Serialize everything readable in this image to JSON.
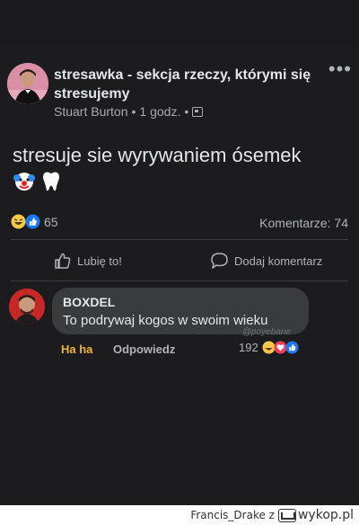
{
  "post": {
    "group_title": "stresawka - sekcja rzeczy, którymi się stresujemy",
    "author": "Stuart Burton",
    "time": "1 godz.",
    "text": "stresuje sie wyrywaniem ósemek",
    "emojis": [
      "clown-face-icon",
      "tooth-icon"
    ],
    "reaction_count": "65",
    "comments_label": "Komentarze: 74",
    "like_label": "Lubię to!",
    "comment_label": "Dodaj komentarz"
  },
  "comment": {
    "author": "BOXDEL",
    "text": "To podrywaj kogos w swoim wieku",
    "watermark": "@poyebane",
    "haha_label": "Ha ha",
    "reply_label": "Odpowiedz",
    "reaction_count": "192"
  },
  "footer": {
    "user": "Francis_Drake z",
    "logo_text": "wykop.pl"
  },
  "colors": {
    "background": "#1c1c1e",
    "bubble": "#3a3b3c",
    "haha": "#f0b33c",
    "like_blue": "#1877f2",
    "love_red": "#f33e58"
  }
}
